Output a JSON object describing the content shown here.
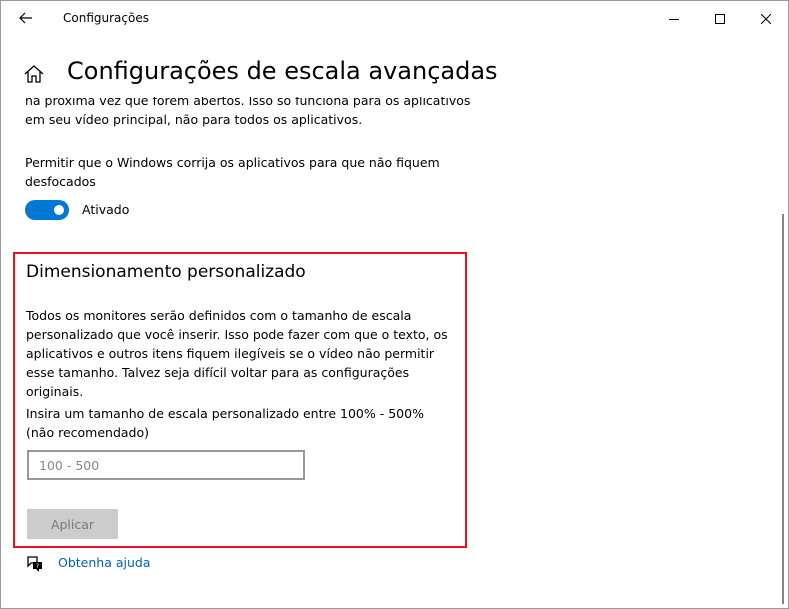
{
  "window": {
    "title": "Configurações",
    "controls": {
      "back_icon": "arrow-left-icon",
      "minimize_icon": "minimize-icon",
      "maximize_icon": "maximize-icon",
      "close_icon": "close-icon"
    }
  },
  "header": {
    "home_icon": "home-icon",
    "title": "Configurações de escala avançadas"
  },
  "content": {
    "clipped_text": "na próxima vez que forem abertos. Isso só funciona para os aplicativos em seu vídeo principal, não para todos os aplicativos.",
    "fix_blurry_label": "Permitir que o Windows corrija os aplicativos para que não fiquem desfocados",
    "toggle": {
      "state_label": "Ativado",
      "on": true
    },
    "custom_scaling": {
      "title": "Dimensionamento personalizado",
      "description": "Todos os monitores serão definidos com o tamanho de escala personalizado que você inserir. Isso pode fazer com que o texto, os aplicativos e outros itens fiquem ilegíveis se o vídeo não permitir esse tamanho. Talvez seja difícil voltar para as configurações originais.",
      "input_label": "Insira um tamanho de escala personalizado entre 100% - 500% (não recomendado)",
      "input_value": "",
      "input_placeholder": "100 - 500",
      "apply_label": "Aplicar",
      "highlight_color": "#e81123"
    },
    "help": {
      "icon": "help-chat-icon",
      "label": "Obtenha ajuda"
    }
  },
  "colors": {
    "accent": "#0078d4",
    "link": "#0063b1"
  }
}
